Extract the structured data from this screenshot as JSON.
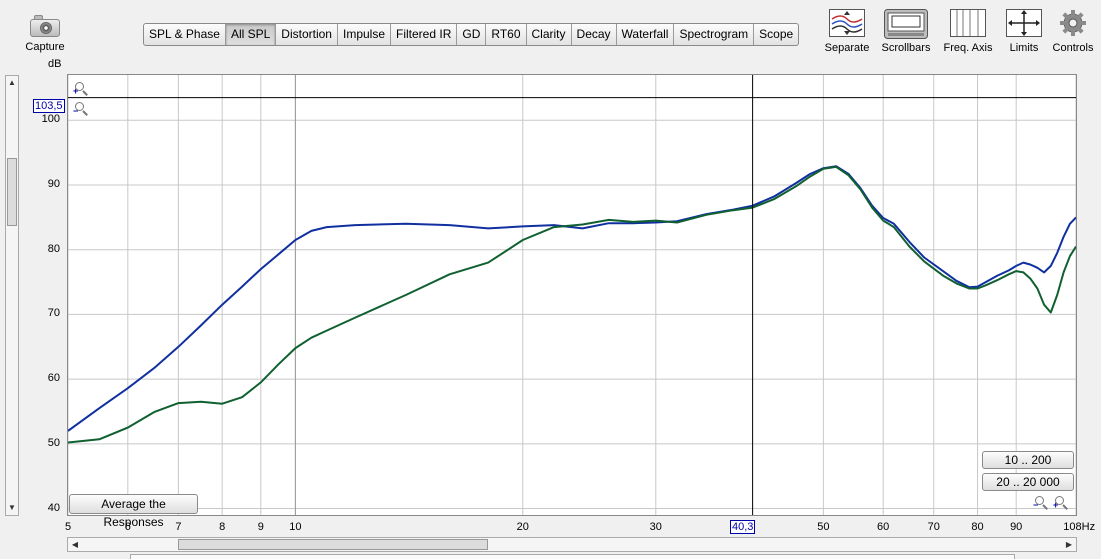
{
  "toolbar": {
    "capture_label": "Capture",
    "tabs": [
      {
        "label": "SPL & Phase"
      },
      {
        "label": "All SPL",
        "active": true
      },
      {
        "label": "Distortion"
      },
      {
        "label": "Impulse"
      },
      {
        "label": "Filtered IR"
      },
      {
        "label": "GD"
      },
      {
        "label": "RT60"
      },
      {
        "label": "Clarity"
      },
      {
        "label": "Decay"
      },
      {
        "label": "Waterfall"
      },
      {
        "label": "Spectrogram"
      },
      {
        "label": "Scope"
      }
    ],
    "separate_label": "Separate",
    "scrollbars_label": "Scrollbars",
    "freq_axis_label": "Freq. Axis",
    "limits_label": "Limits",
    "controls_label": "Controls"
  },
  "plot": {
    "y_unit": "dB",
    "cursor_y_value": "103,5",
    "cursor_x_value": "40,3",
    "average_button": "Average the Responses",
    "range_button_1": "10 .. 200",
    "range_button_2": "20 .. 20 000"
  },
  "colors": {
    "series_blue": "#1030a0",
    "series_green": "#106030",
    "cursor": "#000000",
    "grid": "#c8c8c8"
  },
  "chart_data": {
    "type": "line",
    "x_scale": "log",
    "xlim": [
      5,
      108
    ],
    "ylim": [
      39,
      107
    ],
    "grid": true,
    "x_ticks": [
      {
        "v": 5,
        "label": "5"
      },
      {
        "v": 6,
        "label": "6"
      },
      {
        "v": 7,
        "label": "7"
      },
      {
        "v": 8,
        "label": "8"
      },
      {
        "v": 9,
        "label": "9"
      },
      {
        "v": 10,
        "label": "10"
      },
      {
        "v": 20,
        "label": "20"
      },
      {
        "v": 30,
        "label": "30"
      },
      {
        "v": 50,
        "label": "50"
      },
      {
        "v": 60,
        "label": "60"
      },
      {
        "v": 70,
        "label": "70"
      },
      {
        "v": 80,
        "label": "80"
      },
      {
        "v": 90,
        "label": "90"
      },
      {
        "v": 108,
        "label": "108Hz"
      }
    ],
    "y_ticks": [
      40,
      50,
      60,
      70,
      80,
      90,
      100
    ],
    "cursor": {
      "x": 40.3,
      "y": 103.5
    },
    "series": [
      {
        "color": "#1030a0",
        "points": [
          [
            5,
            52
          ],
          [
            5.5,
            55.5
          ],
          [
            6,
            58.6
          ],
          [
            6.5,
            61.7
          ],
          [
            7,
            65
          ],
          [
            7.5,
            68.3
          ],
          [
            8,
            71.5
          ],
          [
            8.5,
            74.3
          ],
          [
            9,
            77
          ],
          [
            9.5,
            79.3
          ],
          [
            10,
            81.5
          ],
          [
            10.5,
            82.9
          ],
          [
            11,
            83.5
          ],
          [
            12,
            83.8
          ],
          [
            14,
            84
          ],
          [
            16,
            83.8
          ],
          [
            18,
            83.3
          ],
          [
            20,
            83.6
          ],
          [
            22,
            83.8
          ],
          [
            24,
            83.3
          ],
          [
            26,
            84.1
          ],
          [
            28,
            84.1
          ],
          [
            30,
            84.2
          ],
          [
            32,
            84.4
          ],
          [
            35,
            85.5
          ],
          [
            38,
            86.2
          ],
          [
            40.3,
            86.8
          ],
          [
            43,
            88.2
          ],
          [
            46,
            90.3
          ],
          [
            48,
            91.7
          ],
          [
            50,
            92.6
          ],
          [
            52,
            92.9
          ],
          [
            54,
            91.7
          ],
          [
            56,
            89.5
          ],
          [
            58,
            86.8
          ],
          [
            60,
            84.9
          ],
          [
            62,
            84
          ],
          [
            65,
            81.2
          ],
          [
            68,
            78.8
          ],
          [
            72,
            76.7
          ],
          [
            75,
            75.2
          ],
          [
            78,
            74.2
          ],
          [
            80,
            74.3
          ],
          [
            82,
            75
          ],
          [
            85,
            76
          ],
          [
            88,
            76.8
          ],
          [
            90,
            77.5
          ],
          [
            92,
            78
          ],
          [
            94,
            77.7
          ],
          [
            96,
            77.2
          ],
          [
            98,
            76.5
          ],
          [
            100,
            77.5
          ],
          [
            102,
            79.5
          ],
          [
            104,
            82
          ],
          [
            106,
            84
          ],
          [
            108,
            85
          ]
        ]
      },
      {
        "color": "#106030",
        "points": [
          [
            5,
            50.2
          ],
          [
            5.5,
            50.7
          ],
          [
            6,
            52.5
          ],
          [
            6.5,
            54.9
          ],
          [
            7,
            56.3
          ],
          [
            7.5,
            56.5
          ],
          [
            8,
            56.2
          ],
          [
            8.5,
            57.2
          ],
          [
            9,
            59.5
          ],
          [
            9.5,
            62.3
          ],
          [
            10,
            64.8
          ],
          [
            10.5,
            66.4
          ],
          [
            11,
            67.5
          ],
          [
            12,
            69.5
          ],
          [
            14,
            73
          ],
          [
            16,
            76.2
          ],
          [
            18,
            78
          ],
          [
            20,
            81.5
          ],
          [
            22,
            83.5
          ],
          [
            24,
            83.9
          ],
          [
            26,
            84.6
          ],
          [
            28,
            84.3
          ],
          [
            30,
            84.5
          ],
          [
            32,
            84.2
          ],
          [
            35,
            85.4
          ],
          [
            38,
            86.1
          ],
          [
            40.3,
            86.5
          ],
          [
            43,
            87.8
          ],
          [
            46,
            89.8
          ],
          [
            48,
            91.3
          ],
          [
            50,
            92.5
          ],
          [
            52,
            92.8
          ],
          [
            54,
            91.5
          ],
          [
            56,
            89.3
          ],
          [
            58,
            86.5
          ],
          [
            60,
            84.5
          ],
          [
            62,
            83.5
          ],
          [
            65,
            80.5
          ],
          [
            68,
            78.2
          ],
          [
            72,
            76
          ],
          [
            75,
            74.8
          ],
          [
            78,
            74
          ],
          [
            80,
            74
          ],
          [
            82,
            74.5
          ],
          [
            85,
            75.3
          ],
          [
            88,
            76.2
          ],
          [
            90,
            76.7
          ],
          [
            92,
            76.5
          ],
          [
            94,
            75.5
          ],
          [
            96,
            74
          ],
          [
            98,
            71.5
          ],
          [
            100,
            70.3
          ],
          [
            102,
            73
          ],
          [
            104,
            76.5
          ],
          [
            106,
            79
          ],
          [
            108,
            80.5
          ]
        ]
      }
    ]
  }
}
